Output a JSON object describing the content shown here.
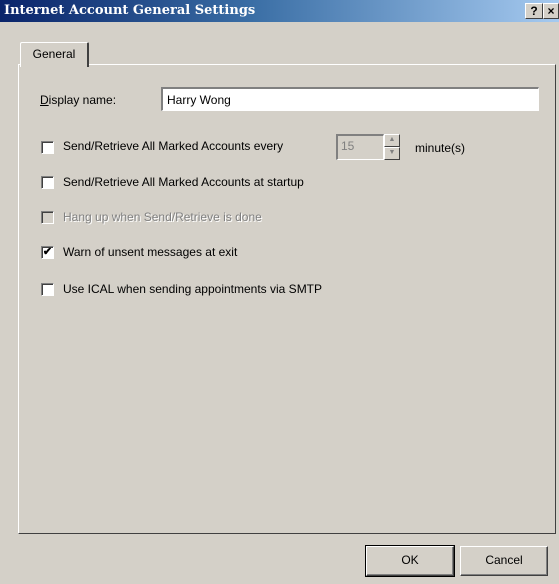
{
  "window": {
    "title": "Internet Account General Settings",
    "help_label": "?",
    "close_label": "×"
  },
  "tabs": [
    {
      "label": "General",
      "selected": true
    }
  ],
  "general": {
    "display_name": {
      "label": "Display name:",
      "value": "Harry Wong"
    },
    "options": [
      {
        "label": "Send/Retrieve All Marked Accounts every",
        "checked": false,
        "enabled": true,
        "interval_value": "15",
        "interval_unit": "minute(s)"
      },
      {
        "label": "Send/Retrieve All Marked Accounts at startup",
        "checked": false,
        "enabled": true
      },
      {
        "label": "Hang up when Send/Retrieve is done",
        "checked": false,
        "enabled": false
      },
      {
        "label": "Warn of unsent messages at exit",
        "checked": true,
        "enabled": true
      },
      {
        "label": "Use ICAL when sending appointments via SMTP",
        "checked": false,
        "enabled": true
      }
    ]
  },
  "buttons": {
    "ok": "OK",
    "cancel": "Cancel"
  },
  "colors": {
    "face": "#d4d0c8",
    "title_gradient_start": "#0a246a",
    "title_gradient_end": "#a6caf0",
    "disabled_text": "#808080"
  }
}
